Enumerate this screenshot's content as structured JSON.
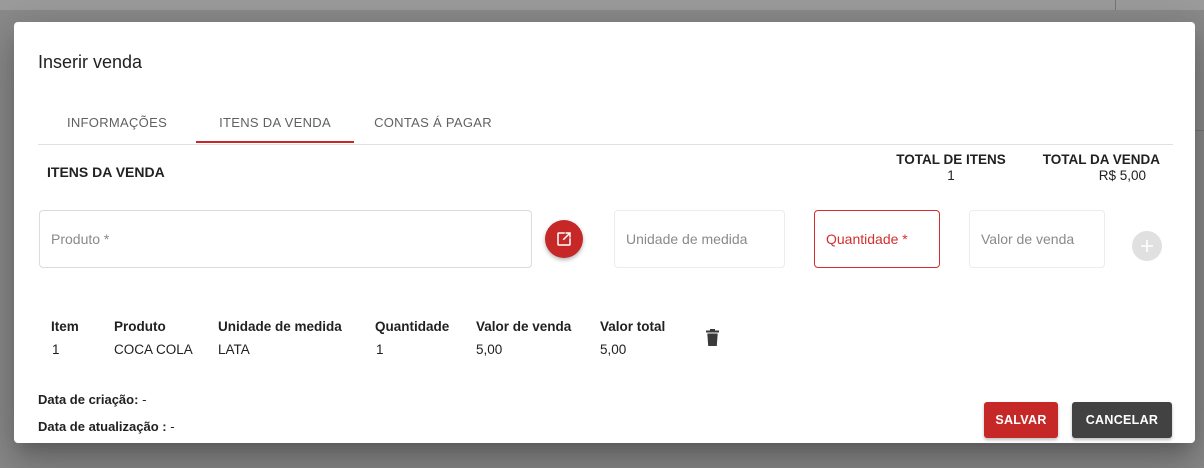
{
  "modal": {
    "title": "Inserir venda"
  },
  "tabs": [
    {
      "label": "INFORMAÇÕES"
    },
    {
      "label": "ITENS DA VENDA"
    },
    {
      "label": "CONTAS Á PAGAR"
    }
  ],
  "active_tab": "ITENS DA VENDA",
  "section": {
    "title": "ITENS DA VENDA",
    "total_items_label": "TOTAL DE ITENS",
    "total_items_value": "1",
    "total_sale_label": "TOTAL DA VENDA",
    "total_sale_value": "R$ 5,00"
  },
  "form": {
    "produto_placeholder": "Produto *",
    "unidade_placeholder": "Unidade de medida",
    "quantidade_placeholder": "Quantidade *",
    "valor_placeholder": "Valor de venda",
    "edit_icon": "open-in-new-icon",
    "add_icon": "plus-icon"
  },
  "table": {
    "headers": [
      "Item",
      "Produto",
      "Unidade de medida",
      "Quantidade",
      "Valor de venda",
      "Valor total"
    ],
    "rows": [
      [
        "1",
        "COCA COLA",
        "LATA",
        "1",
        "5,00",
        "5,00"
      ]
    ],
    "delete_icon": "trash-icon"
  },
  "footer": {
    "created_label": "Data de criação:",
    "created_value": "-",
    "updated_label": "Data de atualização :",
    "updated_value": "-",
    "save_label": "SALVAR",
    "cancel_label": "CANCELAR"
  },
  "colors": {
    "accent": "#c62828",
    "cancel": "#424242",
    "error": "#d32f2f"
  }
}
